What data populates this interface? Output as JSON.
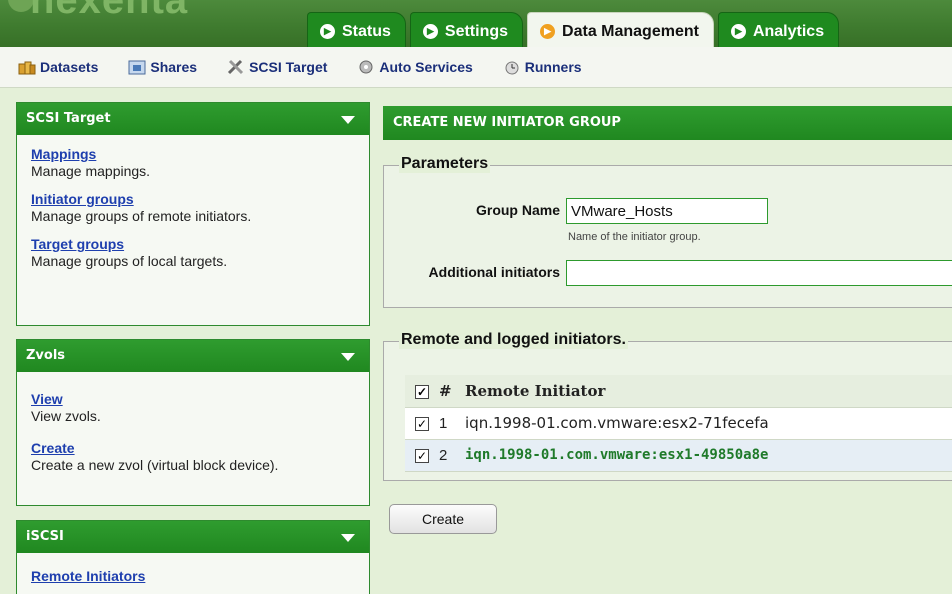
{
  "header": {
    "logo_text": "nexenta",
    "tabs": [
      {
        "label": "Status",
        "active": false
      },
      {
        "label": "Settings",
        "active": false
      },
      {
        "label": "Data Management",
        "active": true
      },
      {
        "label": "Analytics",
        "active": false
      }
    ]
  },
  "subnav": {
    "items": [
      {
        "label": "Datasets",
        "icon": "datasets-icon"
      },
      {
        "label": "Shares",
        "icon": "shares-icon"
      },
      {
        "label": "SCSI Target",
        "icon": "scsi-target-icon"
      },
      {
        "label": "Auto Services",
        "icon": "auto-services-icon"
      },
      {
        "label": "Runners",
        "icon": "runners-icon"
      }
    ]
  },
  "sidebar": {
    "scsi_target": {
      "title": "SCSI Target",
      "entries": [
        {
          "link": "Mappings",
          "desc": "Manage mappings."
        },
        {
          "link": "Initiator groups",
          "desc": "Manage groups of remote initiators."
        },
        {
          "link": "Target groups",
          "desc": "Manage groups of local targets."
        }
      ]
    },
    "zvols": {
      "title": "Zvols",
      "entries": [
        {
          "link": "View",
          "desc": "View zvols."
        },
        {
          "link": "Create",
          "desc": "Create a new zvol (virtual block device)."
        }
      ]
    },
    "iscsi": {
      "title": "iSCSI",
      "entries": [
        {
          "link": "Remote Initiators",
          "desc": ""
        }
      ]
    }
  },
  "main": {
    "title": "CREATE NEW INITIATOR GROUP",
    "parameters": {
      "legend": "Parameters",
      "group_name_label": "Group Name",
      "group_name_value": "VMware_Hosts",
      "group_name_hint": "Name of the initiator group.",
      "additional_label": "Additional initiators",
      "additional_value": ""
    },
    "remote": {
      "legend": "Remote and logged initiators.",
      "col_num": "#",
      "col_name": "Remote Initiator",
      "header_checked": true,
      "rows": [
        {
          "num": "1",
          "name": "iqn.1998-01.com.vmware:esx2-71fecefa",
          "checked": true
        },
        {
          "num": "2",
          "name": "iqn.1998-01.com.vmware:esx1-49850a8e",
          "checked": true
        }
      ]
    },
    "create_label": "Create"
  },
  "colors": {
    "header_green": "#3e7a2e",
    "tab_green": "#1f8a1f",
    "panel_green": "#2a922a",
    "link_blue": "#1e3fae",
    "background": "#e4f0d8"
  }
}
